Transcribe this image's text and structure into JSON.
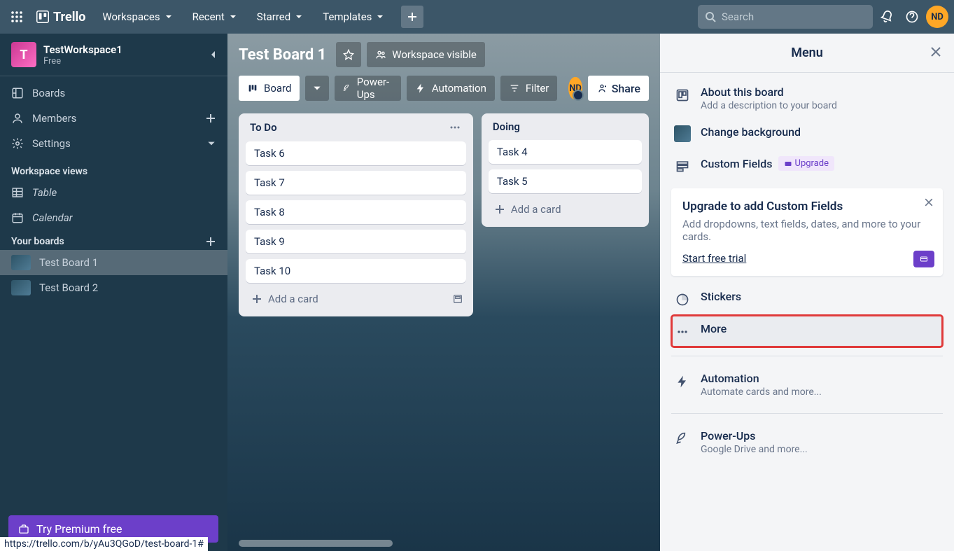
{
  "header": {
    "logo_text": "Trello",
    "nav": [
      "Workspaces",
      "Recent",
      "Starred",
      "Templates"
    ],
    "search_placeholder": "Search",
    "avatar": "ND"
  },
  "sidebar": {
    "workspace_name": "TestWorkspace1",
    "workspace_letter": "T",
    "plan": "Free",
    "items": [
      {
        "label": "Boards"
      },
      {
        "label": "Members"
      },
      {
        "label": "Settings"
      }
    ],
    "views_heading": "Workspace views",
    "views": [
      {
        "label": "Table"
      },
      {
        "label": "Calendar"
      }
    ],
    "boards_heading": "Your boards",
    "boards": [
      {
        "label": "Test Board 1",
        "active": true
      },
      {
        "label": "Test Board 2",
        "active": false
      }
    ],
    "premium_cta": "Try Premium free"
  },
  "board": {
    "title": "Test Board 1",
    "visibility": "Workspace visible",
    "view_label": "Board",
    "buttons": {
      "powerups": "Power-Ups",
      "automation": "Automation",
      "filter": "Filter",
      "share": "Share"
    },
    "member": "ND",
    "lists": [
      {
        "title": "To Do",
        "cards": [
          "Task 6",
          "Task 7",
          "Task 8",
          "Task 9",
          "Task 10"
        ],
        "show_menu": true,
        "narrow": false
      },
      {
        "title": "Doing",
        "cards": [
          "Task 4",
          "Task 5"
        ],
        "show_menu": false,
        "narrow": true
      }
    ],
    "add_card": "Add a card"
  },
  "menu": {
    "title": "Menu",
    "about_title": "About this board",
    "about_sub": "Add a description to your board",
    "change_bg": "Change background",
    "custom_fields": "Custom Fields",
    "upgrade_pill": "Upgrade",
    "promo_title": "Upgrade to add Custom Fields",
    "promo_text": "Add dropdowns, text fields, dates, and more to your cards.",
    "promo_link": "Start free trial",
    "stickers": "Stickers",
    "more": "More",
    "automation_title": "Automation",
    "automation_sub": "Automate cards and more...",
    "powerups_title": "Power-Ups",
    "powerups_sub": "Google Drive and more..."
  },
  "statusbar": "https://trello.com/b/yAu3QGoD/test-board-1#"
}
